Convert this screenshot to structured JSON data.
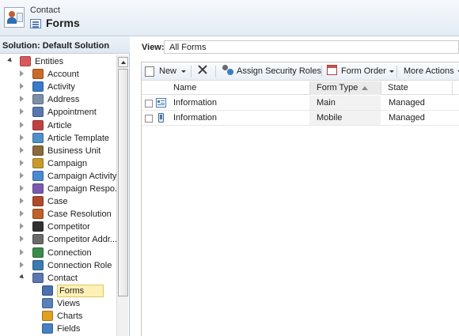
{
  "header": {
    "subtitle": "Contact",
    "title": "Forms"
  },
  "left_panel": {
    "solution_label": "Solution: Default Solution",
    "tree": [
      {
        "label": "Entities",
        "level": 0,
        "state": "expanded",
        "icon": "entities-icon"
      },
      {
        "label": "Account",
        "level": 1,
        "state": "collapsed",
        "icon": "account-icon"
      },
      {
        "label": "Activity",
        "level": 1,
        "state": "collapsed",
        "icon": "activity-icon"
      },
      {
        "label": "Address",
        "level": 1,
        "state": "collapsed",
        "icon": "address-icon"
      },
      {
        "label": "Appointment",
        "level": 1,
        "state": "collapsed",
        "icon": "appointment-icon"
      },
      {
        "label": "Article",
        "level": 1,
        "state": "collapsed",
        "icon": "article-icon"
      },
      {
        "label": "Article Template",
        "level": 1,
        "state": "collapsed",
        "icon": "article-template-icon"
      },
      {
        "label": "Business Unit",
        "level": 1,
        "state": "collapsed",
        "icon": "business-unit-icon"
      },
      {
        "label": "Campaign",
        "level": 1,
        "state": "collapsed",
        "icon": "campaign-icon"
      },
      {
        "label": "Campaign Activity",
        "level": 1,
        "state": "collapsed",
        "icon": "campaign-activity-icon"
      },
      {
        "label": "Campaign Respo...",
        "level": 1,
        "state": "collapsed",
        "icon": "campaign-response-icon"
      },
      {
        "label": "Case",
        "level": 1,
        "state": "collapsed",
        "icon": "case-icon"
      },
      {
        "label": "Case Resolution",
        "level": 1,
        "state": "collapsed",
        "icon": "case-resolution-icon"
      },
      {
        "label": "Competitor",
        "level": 1,
        "state": "collapsed",
        "icon": "competitor-icon"
      },
      {
        "label": "Competitor Addr...",
        "level": 1,
        "state": "collapsed",
        "icon": "competitor-address-icon"
      },
      {
        "label": "Connection",
        "level": 1,
        "state": "collapsed",
        "icon": "connection-icon"
      },
      {
        "label": "Connection Role",
        "level": 1,
        "state": "collapsed",
        "icon": "connection-role-icon"
      },
      {
        "label": "Contact",
        "level": 1,
        "state": "expanded",
        "icon": "contact-icon"
      },
      {
        "label": "Forms",
        "level": 2,
        "state": "leaf",
        "icon": "forms-icon",
        "selected": true
      },
      {
        "label": "Views",
        "level": 2,
        "state": "leaf",
        "icon": "views-icon"
      },
      {
        "label": "Charts",
        "level": 2,
        "state": "leaf",
        "icon": "charts-icon"
      },
      {
        "label": "Fields",
        "level": 2,
        "state": "leaf",
        "icon": "fields-icon"
      }
    ]
  },
  "view_bar": {
    "label": "View:",
    "value": "All Forms"
  },
  "toolbar": {
    "new_label": "New",
    "assign_security_roles_label": "Assign Security Roles",
    "form_order_label": "Form Order",
    "more_actions_label": "More Actions"
  },
  "grid": {
    "columns": [
      "Name",
      "Form Type",
      "State"
    ],
    "rows": [
      {
        "name": "Information",
        "form_type": "Main",
        "state": "Managed",
        "icon": "main-form-icon"
      },
      {
        "name": "Information",
        "form_type": "Mobile",
        "state": "Managed",
        "icon": "mobile-form-icon"
      }
    ]
  },
  "colors": {
    "header_bg": "#e3ebf4",
    "selection_bg": "#fdf1b6",
    "selection_border": "#e4c45a",
    "panel_border": "#b9c6d5"
  }
}
